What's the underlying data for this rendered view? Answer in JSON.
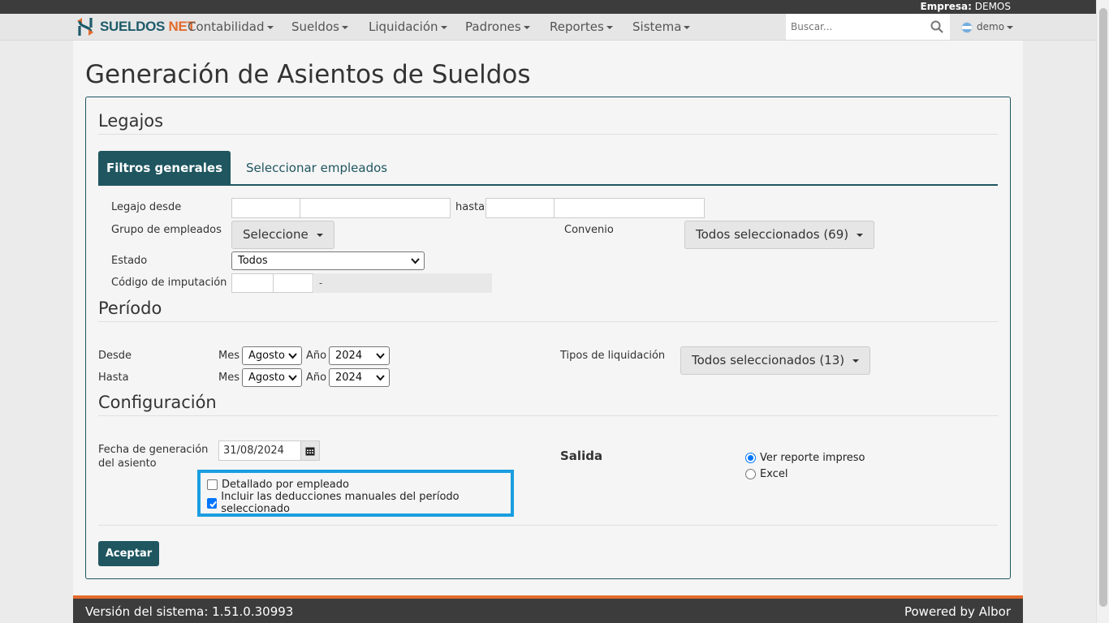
{
  "topbar": {
    "empresa_label": "Empresa:",
    "empresa_value": "DEMOS"
  },
  "brand": {
    "name_main": "SUELDOS",
    "name_suffix": "NET",
    "icon": "sueldos-net-logo"
  },
  "nav": {
    "items": [
      "Contabilidad",
      "Sueldos",
      "Liquidación",
      "Padrones",
      "Reportes",
      "Sistema"
    ],
    "search_placeholder": "Buscar...",
    "user": "demo",
    "icons": {
      "search": "search-icon",
      "flag": "argentina-flag-icon"
    }
  },
  "page": {
    "title": "Generación de Asientos de Sueldos"
  },
  "legajos": {
    "title": "Legajos",
    "tabs": [
      "Filtros generales",
      "Seleccionar empleados"
    ],
    "legajo_desde_label": "Legajo desde",
    "hasta_label": "hasta",
    "grupo_label": "Grupo de empleados",
    "grupo_value": "Seleccione",
    "convenio_label": "Convenio",
    "convenio_value": "Todos seleccionados (69)",
    "estado_label": "Estado",
    "estado_value": "Todos",
    "codigo_label": "Código de imputación",
    "codigo_desc": "-"
  },
  "periodo": {
    "title": "Período",
    "desde_label": "Desde",
    "hasta_label": "Hasta",
    "mes_label": "Mes",
    "anio_label": "Año",
    "desde_mes": "Agosto",
    "desde_anio": "2024",
    "hasta_mes": "Agosto",
    "hasta_anio": "2024",
    "tipos_label": "Tipos de liquidación",
    "tipos_value": "Todos seleccionados (13)"
  },
  "config": {
    "title": "Configuración",
    "fecha_label_1": "Fecha de generación",
    "fecha_label_2": "del asiento",
    "fecha_value": "31/08/2024",
    "detallado_label": "Detallado por empleado",
    "detallado_checked": false,
    "incluir_label": "Incluir las deducciones manuales del período seleccionado",
    "incluir_checked": true,
    "salida_label": "Salida",
    "salida_options": [
      "Ver reporte impreso",
      "Excel"
    ],
    "salida_selected": "Ver reporte impreso"
  },
  "actions": {
    "accept": "Aceptar"
  },
  "footer": {
    "version": "Versión del sistema: 1.51.0.30993",
    "powered": "Powered by Albor"
  },
  "colors": {
    "primary": "#1f5660",
    "accent": "#e36b2c",
    "highlight": "#1a9ee0",
    "topbar": "#3c3c3c"
  }
}
